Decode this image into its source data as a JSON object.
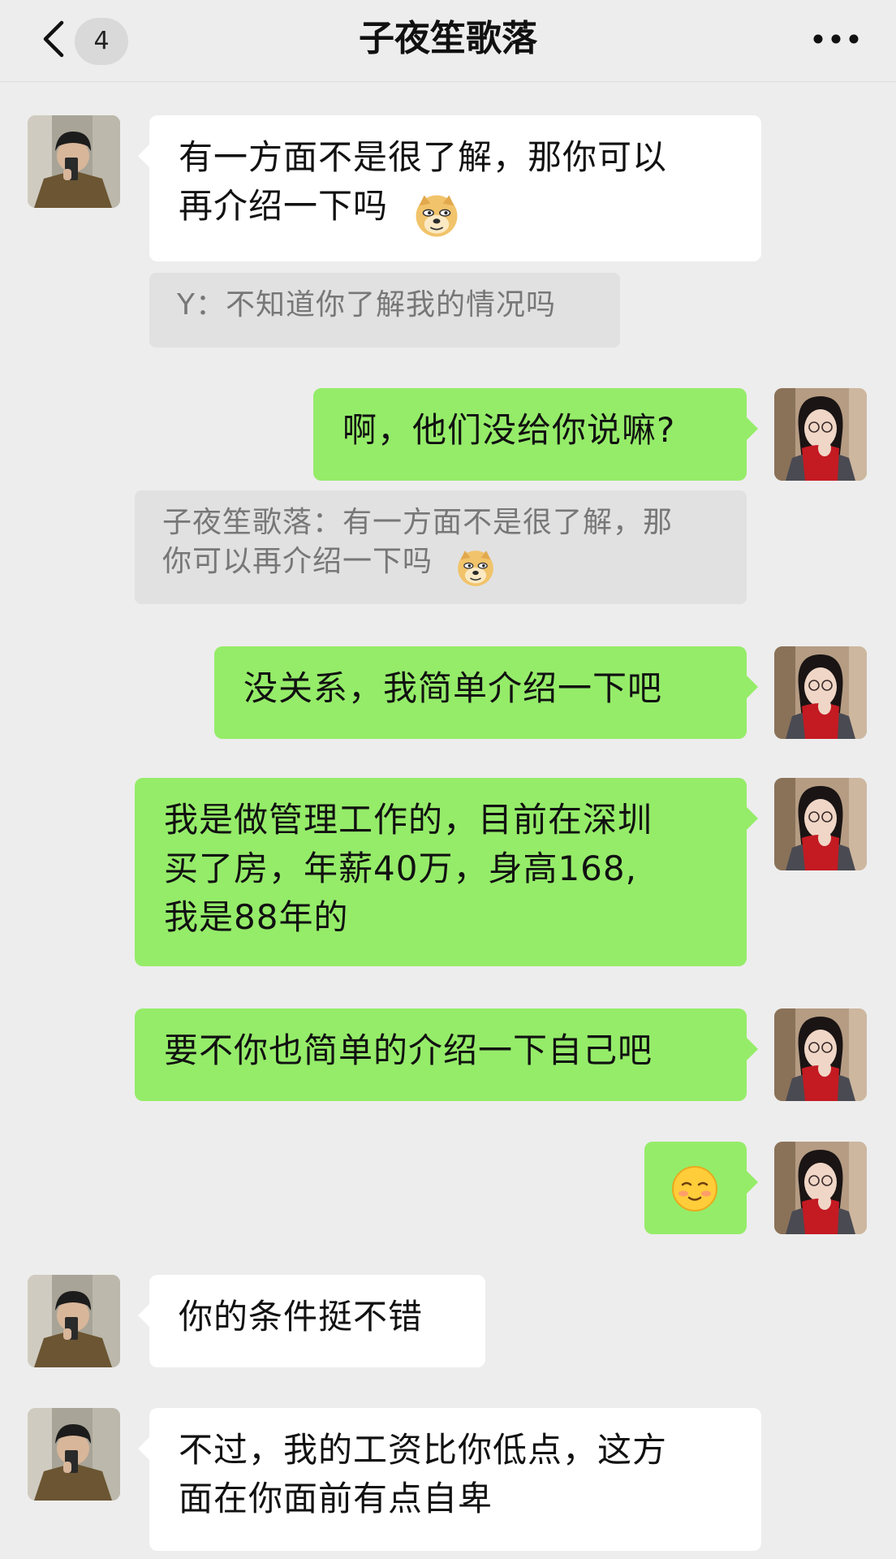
{
  "header": {
    "title": "子夜笙歌落",
    "unread_count": "4",
    "back_icon": "chevron-left-icon",
    "more_icon": "more-dots-icon"
  },
  "messages": [
    {
      "side": "in",
      "text": "有一方面不是很了解，那你可以\n再介绍一下吗",
      "emoji": "doge-emoji"
    },
    {
      "type": "quote",
      "text": "Y：不知道你了解我的情况吗"
    },
    {
      "side": "out",
      "text": "啊，他们没给你说嘛?"
    },
    {
      "type": "quote",
      "text": "子夜笙歌落：有一方面不是很了解，那\n你可以再介绍一下吗",
      "emoji": "doge-emoji"
    },
    {
      "side": "out",
      "text": "没关系，我简单介绍一下吧"
    },
    {
      "side": "out",
      "text": "我是做管理工作的，目前在深圳\n买了房，年薪40万，身高168,\n我是88年的"
    },
    {
      "side": "out",
      "text": "要不你也简单的介绍一下自己吧"
    },
    {
      "side": "out",
      "emoji": "shy-smile-emoji"
    },
    {
      "side": "in",
      "text": "你的条件挺不错"
    },
    {
      "side": "in",
      "text": "不过，我的工资比你低点，这方\n面在你面前有点自卑"
    }
  ],
  "colors": {
    "background": "#ededed",
    "incoming_bubble": "#ffffff",
    "outgoing_bubble": "#95ec69",
    "quote_bg": "#e1e1e1"
  }
}
